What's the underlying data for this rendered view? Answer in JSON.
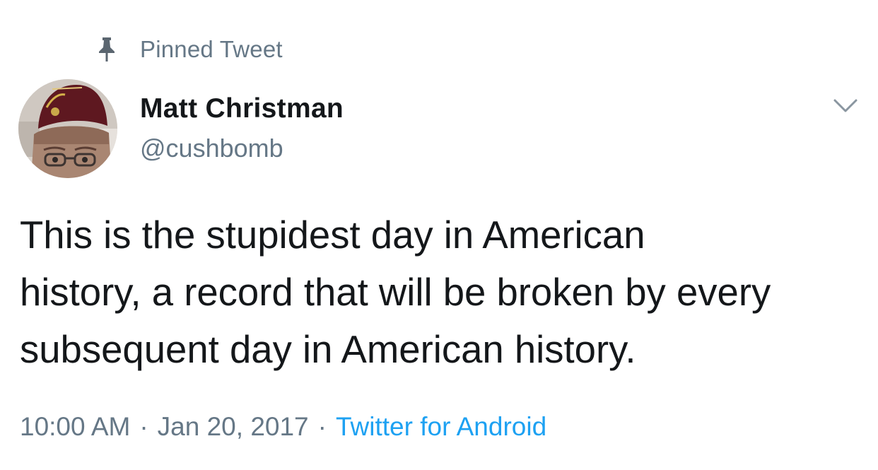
{
  "pinned": {
    "label": "Pinned Tweet",
    "icon": "pin-icon"
  },
  "author": {
    "display_name": "Matt Christman",
    "handle": "@cushbomb",
    "avatar_icon": "avatar"
  },
  "menu": {
    "icon": "chevron-down-icon"
  },
  "tweet": {
    "lines": [
      "This is the stupidest day in American",
      "history, a record that will be broken by every",
      "subsequent day in American history."
    ]
  },
  "meta": {
    "time": "10:00 AM",
    "separator": "·",
    "date": "Jan 20, 2017",
    "source": "Twitter for Android"
  },
  "colors": {
    "text": "#14171a",
    "secondary": "#657786",
    "link": "#1da1f2",
    "background": "#ffffff"
  }
}
